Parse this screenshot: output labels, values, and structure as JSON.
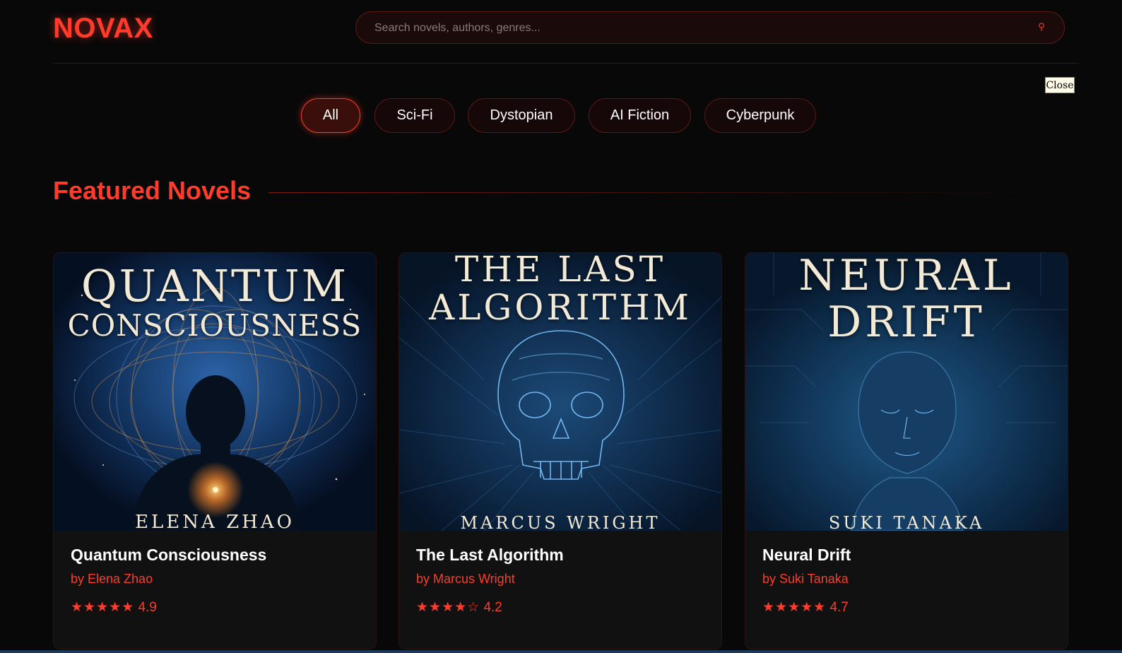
{
  "header": {
    "logo": "NOVAX",
    "search_placeholder": "Search novels, authors, genres...",
    "search_icon": "search-icon"
  },
  "close_label": "Close",
  "filters": [
    {
      "label": "All",
      "active": true
    },
    {
      "label": "Sci-Fi",
      "active": false
    },
    {
      "label": "Dystopian",
      "active": false
    },
    {
      "label": "AI Fiction",
      "active": false
    },
    {
      "label": "Cyberpunk",
      "active": false
    }
  ],
  "section": {
    "title": "Featured Novels"
  },
  "books": [
    {
      "cover_title_line1": "QUANTUM",
      "cover_title_line2": "CONSCIOUSNESS",
      "cover_author": "ELENA ZHAO",
      "title": "Quantum Consciousness",
      "author": "by Elena Zhao",
      "stars": "★★★★★",
      "rating": "4.9"
    },
    {
      "cover_title_line1": "THE LAST",
      "cover_title_line2": "ALGORITHM",
      "cover_author": "MARCUS WRIGHT",
      "title": "The Last Algorithm",
      "author": "by Marcus Wright",
      "stars": "★★★★☆",
      "rating": "4.2"
    },
    {
      "cover_title_line1": "NEURAL",
      "cover_title_line2": "DRIFT",
      "cover_author": "SUKI TANAKA",
      "title": "Neural Drift",
      "author": "by Suki Tanaka",
      "stars": "★★★★★",
      "rating": "4.7"
    }
  ],
  "colors": {
    "accent": "#ff3b2b",
    "background": "#080808",
    "card": "#111111",
    "cover_blue": "#0f2a4a",
    "cover_text": "#f3ead6"
  }
}
